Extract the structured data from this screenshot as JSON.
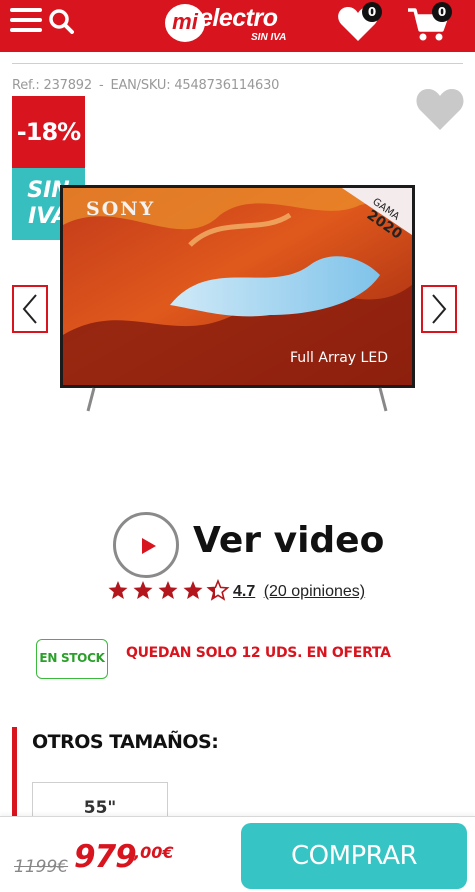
{
  "header": {
    "logo_circle": "mi",
    "logo_word": "electro",
    "logo_sub": "SIN IVA",
    "wishlist_count": "0",
    "cart_count": "0",
    "icons": [
      "menu-icon",
      "search-icon",
      "heart-icon",
      "cart-icon"
    ]
  },
  "product": {
    "ref_label": "Ref.: 237892",
    "separator": "-",
    "ean_label": "EAN/SKU: 4548736114630",
    "discount_badge": "-18%",
    "siniva_line1": "SIN",
    "siniva_line2": "IVA",
    "image": {
      "brand_text": "SONY",
      "corner_text_1": "GAMA",
      "corner_text_2": "2020",
      "feature_text": "Full Array LED"
    },
    "video_label": "Ver video",
    "rating_value": "4.7",
    "rating_count": "(20 opiniones)",
    "rating_stars": 4.5,
    "stock_label": "EN STOCK",
    "offer_text": "QUEDAN SOLO 12 UDS. EN OFERTA",
    "sizes_title": "OTROS TAMAÑOS:",
    "sizes": [
      "55\""
    ]
  },
  "purchase": {
    "old_price": "1199€",
    "price_int": "979",
    "price_dec": ",00€",
    "buy_label": "COMPRAR"
  },
  "colors": {
    "brand_red": "#d8141f",
    "teal": "#37c4c4",
    "stock_green": "#3cba3c"
  }
}
